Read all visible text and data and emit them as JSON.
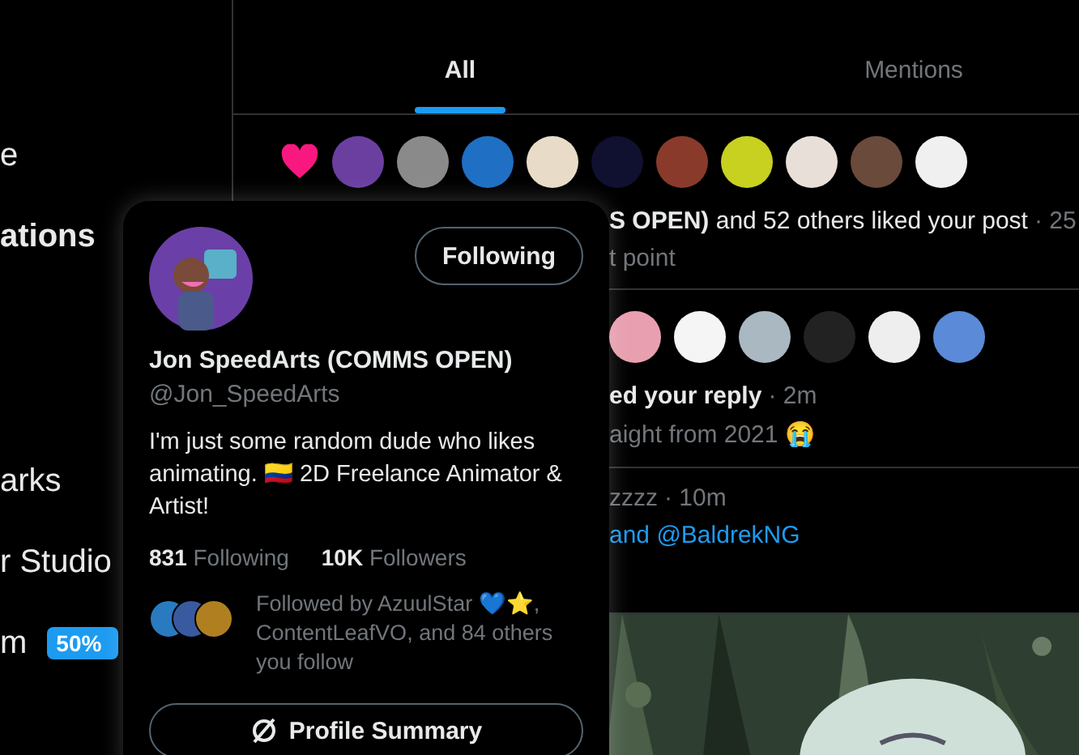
{
  "sidebar": {
    "top_items": [
      {
        "label": "e",
        "selected": false
      },
      {
        "label": "ations",
        "selected": true
      }
    ],
    "bottom_items": [
      {
        "label": "arks",
        "selected": false
      },
      {
        "label": "r Studio",
        "selected": false
      },
      {
        "label": "m",
        "selected": false,
        "badge": "50%"
      }
    ]
  },
  "tabs": [
    {
      "label": "All",
      "selected": true
    },
    {
      "label": "Mentions",
      "selected": false
    }
  ],
  "notifications": [
    {
      "kind": "like",
      "avatars": [
        {
          "color": "#6b3fa0"
        },
        {
          "color": "#8a8a8a"
        },
        {
          "color": "#1f6fc4"
        },
        {
          "color": "#e8dcc8"
        },
        {
          "color": "#101030"
        },
        {
          "color": "#8a3a2a"
        },
        {
          "color": "#c8d020"
        },
        {
          "color": "#e8e0d8"
        },
        {
          "color": "#6a4a3a"
        },
        {
          "color": "#f0f0f0"
        }
      ],
      "headline": "**S OPEN)** and 52 others liked your post",
      "time": "· 25",
      "snippet": "t point"
    },
    {
      "kind": "reply",
      "avatars": [
        {
          "color": "#e8a0b0"
        },
        {
          "color": "#f5f5f5"
        },
        {
          "color": "#aab8c2"
        },
        {
          "color": "#222222"
        },
        {
          "color": "#eeeeee"
        },
        {
          "color": "#5a8ad8"
        }
      ],
      "headline": "**ed your reply**",
      "time": "· 2m",
      "snippet": "aight from 2021 😭"
    },
    {
      "kind": "mention",
      "headline": "zzzz",
      "time": "· 10m",
      "link": "and @BaldrekNG"
    },
    {
      "kind": "media"
    }
  ],
  "hover_card": {
    "name": "Jon SpeedArts (COMMS OPEN)",
    "handle": "@Jon_SpeedArts",
    "follow_button": "Following",
    "bio": "I'm just some random dude who likes animating. 🇨🇴 2D Freelance Animator & Artist!",
    "stats": [
      "**831** Following",
      "**10K** Followers"
    ],
    "followed_by": "Followed by AzuulStar 💙⭐, ContentLeafVO, and 84 others you follow",
    "followed_avatars": [
      {
        "color": "#2a7ac0"
      },
      {
        "color": "#3a5aa0"
      },
      {
        "color": "#b08020"
      }
    ],
    "summary_button": "Profile Summary"
  }
}
